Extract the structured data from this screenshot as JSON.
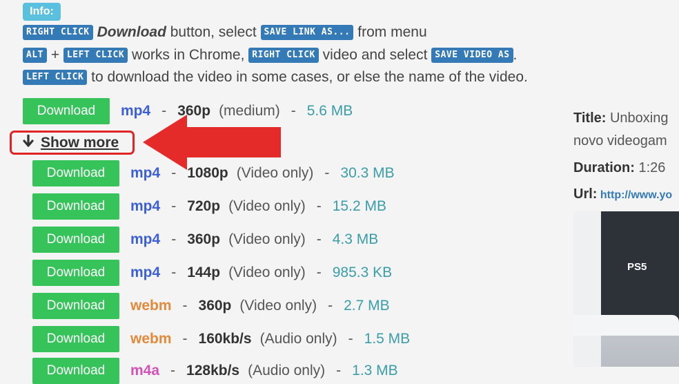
{
  "info": {
    "badge": "Info:",
    "line1": {
      "k1": "RIGHT CLICK",
      "t1": "Download",
      "t2": " button, select ",
      "k2": "SAVE LINK AS...",
      "t3": " from menu"
    },
    "line2": {
      "k1": "ALT",
      "t1": " + ",
      "k2": "LEFT CLICK",
      "t2": " works in Chrome, ",
      "k3": "RIGHT CLICK",
      "t3": " video and select ",
      "k4": "SAVE VIDEO AS",
      "t4": "."
    },
    "line3": {
      "k1": "LEFT CLICK",
      "t1": " to download the video in some cases, or else the name of the video."
    }
  },
  "download_label": "Download",
  "separator": "-",
  "main_row": {
    "format": "mp4",
    "quality": "360p",
    "note": "(medium)",
    "size": "5.6 MB"
  },
  "show_more": "Show more",
  "rows": [
    {
      "format": "mp4",
      "quality": "1080p",
      "note": "(Video only)",
      "size": "30.3 MB"
    },
    {
      "format": "mp4",
      "quality": "720p",
      "note": "(Video only)",
      "size": "15.2 MB"
    },
    {
      "format": "mp4",
      "quality": "360p",
      "note": "(Video only)",
      "size": "4.3 MB"
    },
    {
      "format": "mp4",
      "quality": "144p",
      "note": "(Video only)",
      "size": "985.3 KB"
    },
    {
      "format": "webm",
      "quality": "360p",
      "note": "(Video only)",
      "size": "2.7 MB"
    },
    {
      "format": "webm",
      "quality": "160kb/s",
      "note": "(Audio only)",
      "size": "1.5 MB"
    },
    {
      "format": "m4a",
      "quality": "128kb/s",
      "note": "(Audio only)",
      "size": "1.3 MB"
    }
  ],
  "sidebar": {
    "title_label": "Title:",
    "title_value_1": " Unboxing",
    "title_value_2": "novo videogam",
    "duration_label": "Duration:",
    "duration_value": " 1:26",
    "url_label": "Url:",
    "url_value": " http://www.yo"
  },
  "thumbnail": {
    "logo": "PS5",
    "icon": "video-thumbnail"
  },
  "colors": {
    "download": "#35c35a",
    "kbd": "#337ab7",
    "info": "#5bc0de",
    "highlight": "#e02424"
  }
}
